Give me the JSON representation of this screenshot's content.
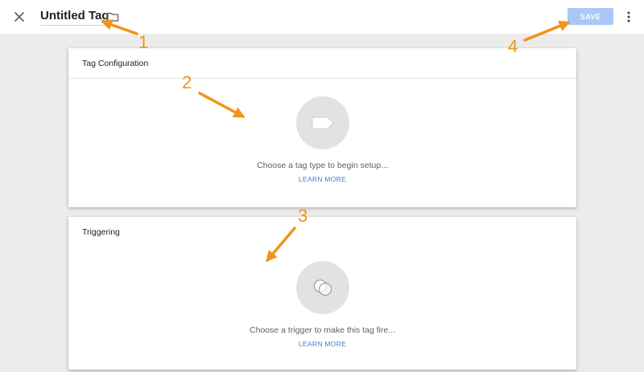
{
  "header": {
    "close_icon": "close-icon",
    "title": "Untitled Tag",
    "folder_icon": "folder-icon",
    "save_label": "SAVE",
    "more_icon": "more-vert-icon"
  },
  "tag_configuration": {
    "heading": "Tag Configuration",
    "icon": "tag-icon",
    "hint": "Choose a tag type to begin setup...",
    "learn_more": "LEARN MORE"
  },
  "triggering": {
    "heading": "Triggering",
    "icon": "trigger-rings-icon",
    "hint": "Choose a trigger to make this tag fire...",
    "learn_more": "LEARN MORE"
  },
  "annotations": {
    "color": "#f39318",
    "labels": [
      "1",
      "2",
      "3",
      "4"
    ]
  },
  "colors": {
    "accent": "#3f7ad8",
    "save_disabled": "#a9c8f6",
    "background": "#ececec"
  }
}
